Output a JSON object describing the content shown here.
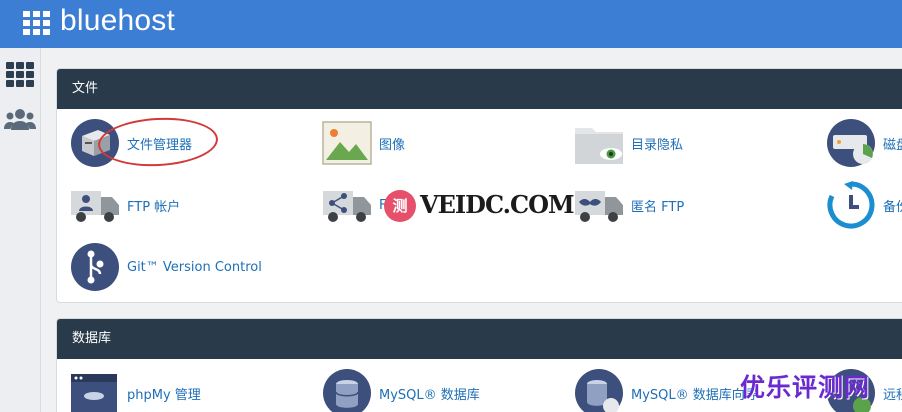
{
  "header": {
    "brand": "bluehost",
    "colors": {
      "topbar": "#3c7ed3",
      "panel_header": "#293a4a",
      "link": "#1e6fb8"
    }
  },
  "sidebar": {
    "items": [
      {
        "icon": "apps-grid-icon"
      },
      {
        "icon": "users-icon"
      }
    ]
  },
  "sections": {
    "files": {
      "title": "文件",
      "items": [
        {
          "label": "文件管理器",
          "icon": "file-manager-icon",
          "highlighted": true
        },
        {
          "label": "图像",
          "icon": "images-icon"
        },
        {
          "label": "目录隐私",
          "icon": "directory-privacy-icon"
        },
        {
          "label": "磁盘",
          "icon": "disk-usage-icon"
        },
        {
          "label": "FTP 帐户",
          "icon": "ftp-accounts-icon"
        },
        {
          "label": "F",
          "icon": "ftp-connections-icon"
        },
        {
          "label": "匿名 FTP",
          "icon": "anonymous-ftp-icon"
        },
        {
          "label": "备份",
          "icon": "backup-icon"
        },
        {
          "label": "Git™ Version Control",
          "icon": "git-icon"
        }
      ]
    },
    "databases": {
      "title": "数据库",
      "items": [
        {
          "label": "phpMy 管理",
          "icon": "phpmyadmin-icon"
        },
        {
          "label": "MySQL® 数据库",
          "icon": "mysql-databases-icon"
        },
        {
          "label": "MySQL® 数据库向导",
          "icon": "mysql-wizard-icon"
        },
        {
          "label": "远程",
          "icon": "remote-mysql-icon"
        }
      ]
    }
  },
  "watermarks": {
    "veidc_badge": "测",
    "veidc_text": "VEIDC.COM",
    "youle": "优乐评测网"
  }
}
